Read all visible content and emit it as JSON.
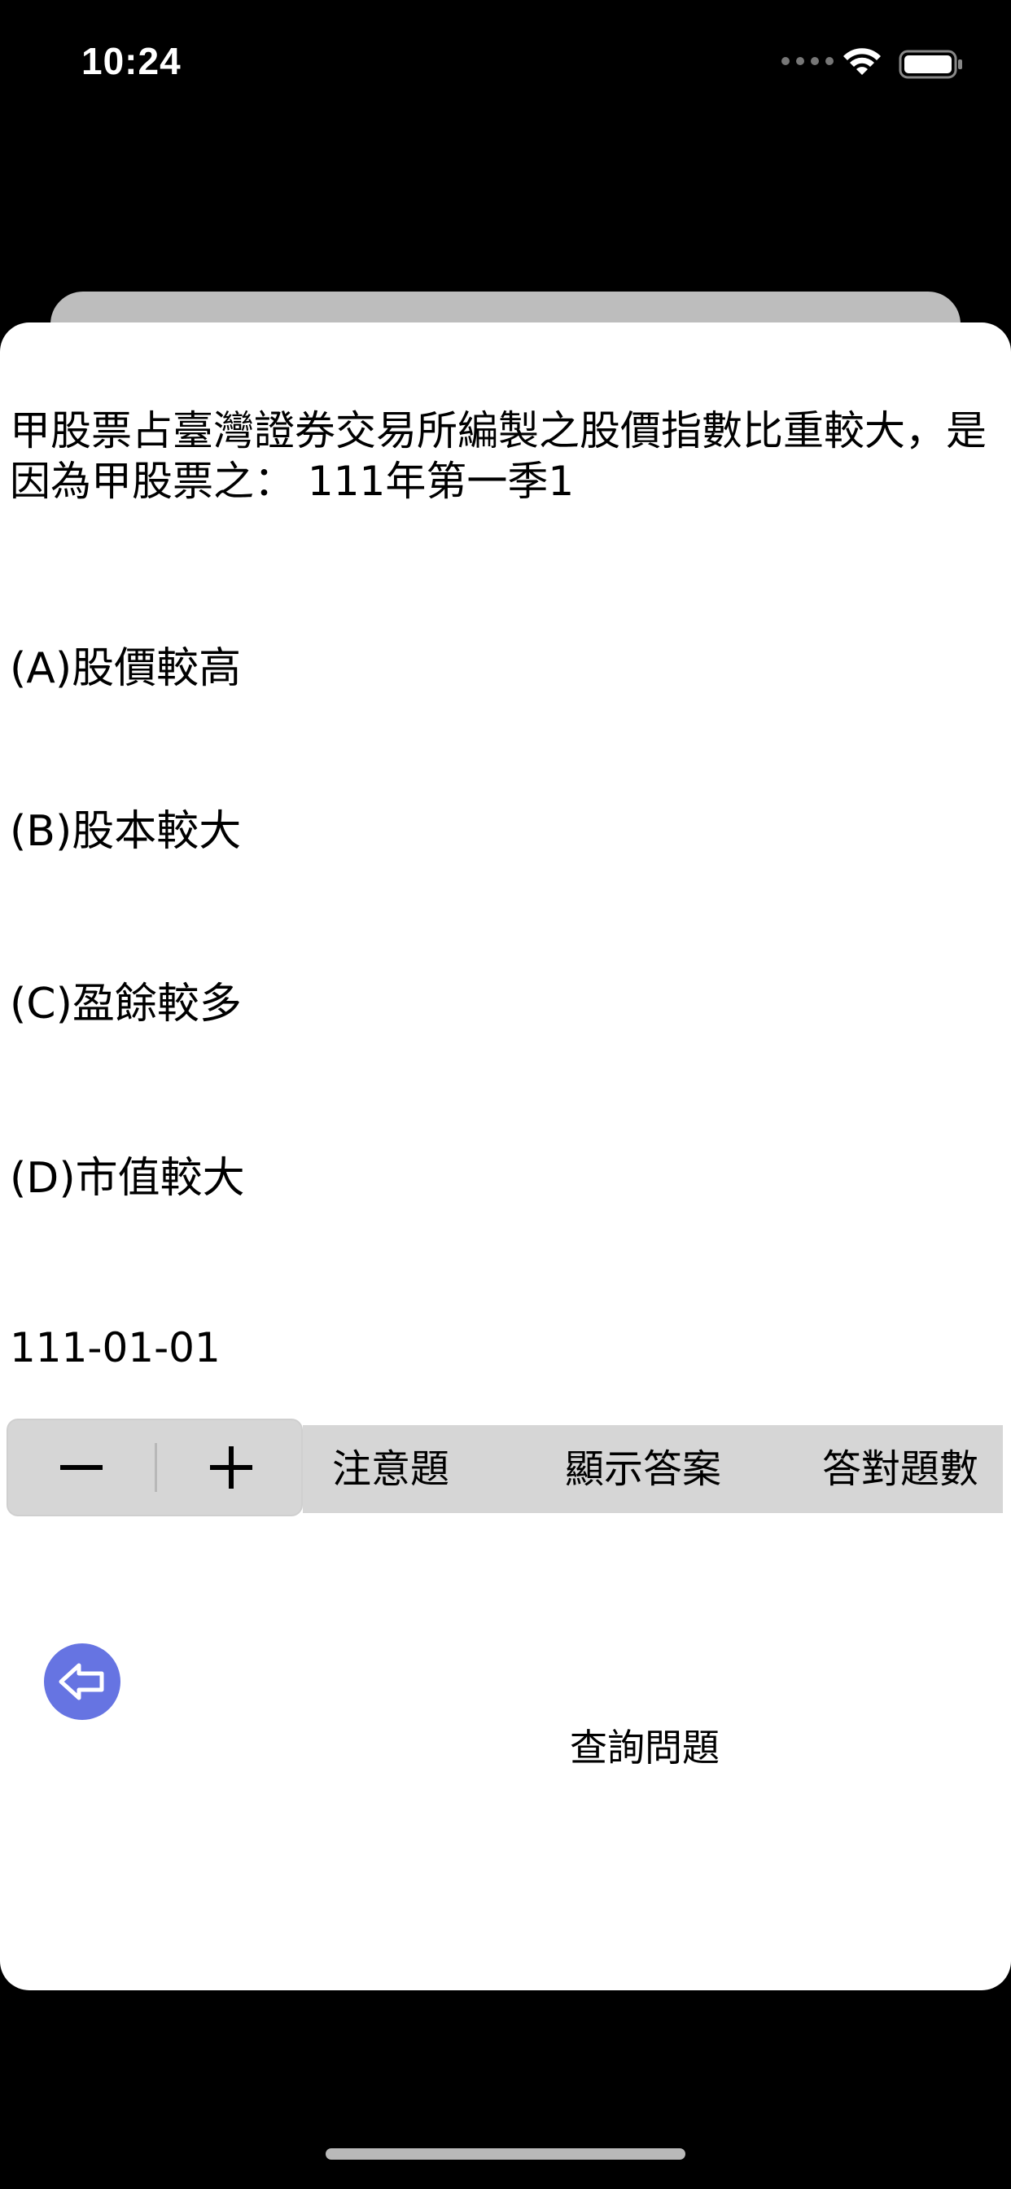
{
  "status_bar": {
    "time": "10:24"
  },
  "question": {
    "text": "甲股票占臺灣證券交易所編製之股價指數比重較大，是因為甲股票之：  111年第一季1",
    "options": [
      {
        "label": "(A)股價較高"
      },
      {
        "label": "(B)股本較大"
      },
      {
        "label": "(C)盈餘較多"
      },
      {
        "label": "(D)市值較大"
      }
    ],
    "date": "111-01-01"
  },
  "toolbar": {
    "mark_label": "注意題",
    "show_answer_label": "顯示答案",
    "correct_count_label": "答對題數"
  },
  "query": {
    "label": "查詢問題"
  },
  "colors": {
    "accent": "#6674e2",
    "toolbar_bg": "#d6d6d6"
  },
  "icons": {
    "stepper_minus": "minus-icon",
    "stepper_plus": "plus-icon",
    "back": "arrow-left-icon"
  }
}
